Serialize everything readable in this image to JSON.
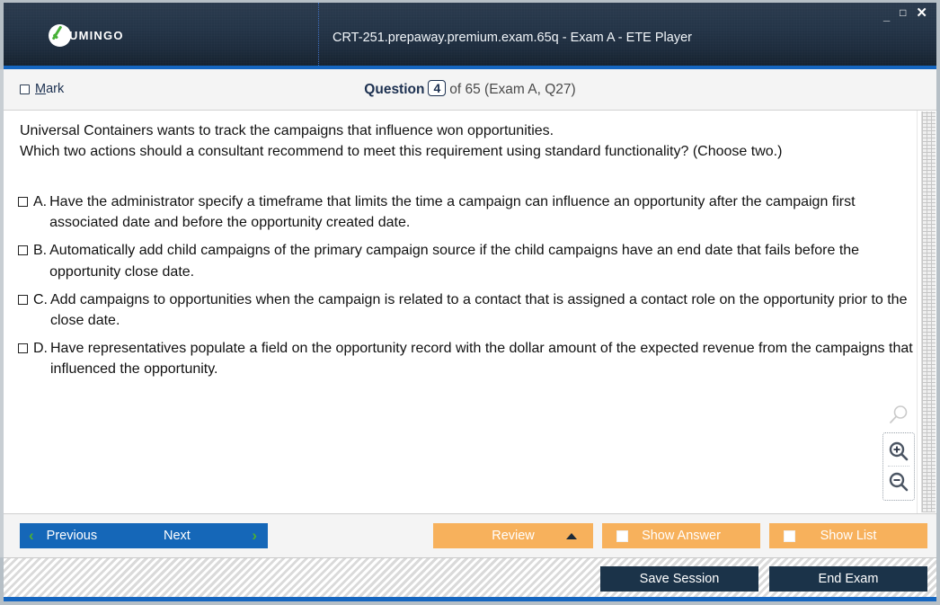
{
  "window": {
    "title": "CRT-251.prepaway.premium.exam.65q - Exam A - ETE Player",
    "logo_text": "UMINGO",
    "controls": {
      "minimize": "_",
      "maximize": "□",
      "close": "✕"
    }
  },
  "header": {
    "mark_label_prefix": "M",
    "mark_label_rest": "ark",
    "question_word": "Question",
    "question_number": "4",
    "of_text": "of 65 (Exam A, Q27)"
  },
  "question": {
    "line1": "Universal Containers wants to track the campaigns that influence won opportunities.",
    "line2": "Which two actions should a consultant recommend to meet this requirement using standard functionality? (Choose two.)",
    "options": [
      {
        "letter": "A.",
        "text": "Have the administrator specify a timeframe that limits the time a campaign can influence an opportunity after the campaign first associated date and before the opportunity created date.",
        "checked": false
      },
      {
        "letter": "B.",
        "text": "Automatically add child campaigns of the primary campaign source if the child campaigns have an end date that fails before the opportunity close date.",
        "checked": false
      },
      {
        "letter": "C.",
        "text": "Add campaigns to opportunities when the campaign is related to a contact that is assigned a contact role on the opportunity prior to the close date.",
        "checked": false
      },
      {
        "letter": "D.",
        "text": "Have representatives populate a field on the opportunity record with the dollar amount of the expected revenue from the campaigns that influenced the opportunity.",
        "checked": false
      }
    ]
  },
  "zoom_controls": {
    "ghost_icon": "magnifier-icon",
    "zoom_in_icon": "zoom-in-icon",
    "zoom_out_icon": "zoom-out-icon"
  },
  "nav": {
    "previous": "Previous",
    "next": "Next",
    "review": "Review",
    "show_answer": "Show Answer",
    "show_list": "Show List",
    "prev_chevron": "‹",
    "next_chevron": "›"
  },
  "footer": {
    "save_session": "Save Session",
    "end_exam": "End Exam"
  },
  "colors": {
    "titlebar": "#24354a",
    "accent_blue": "#1566c0",
    "button_blue": "#1567b8",
    "button_orange": "#f7b15c",
    "button_dark": "#1b3349",
    "chevron_green": "#4caf33",
    "logo_check_green": "#45b035",
    "header_navy_text": "#1c3050"
  }
}
